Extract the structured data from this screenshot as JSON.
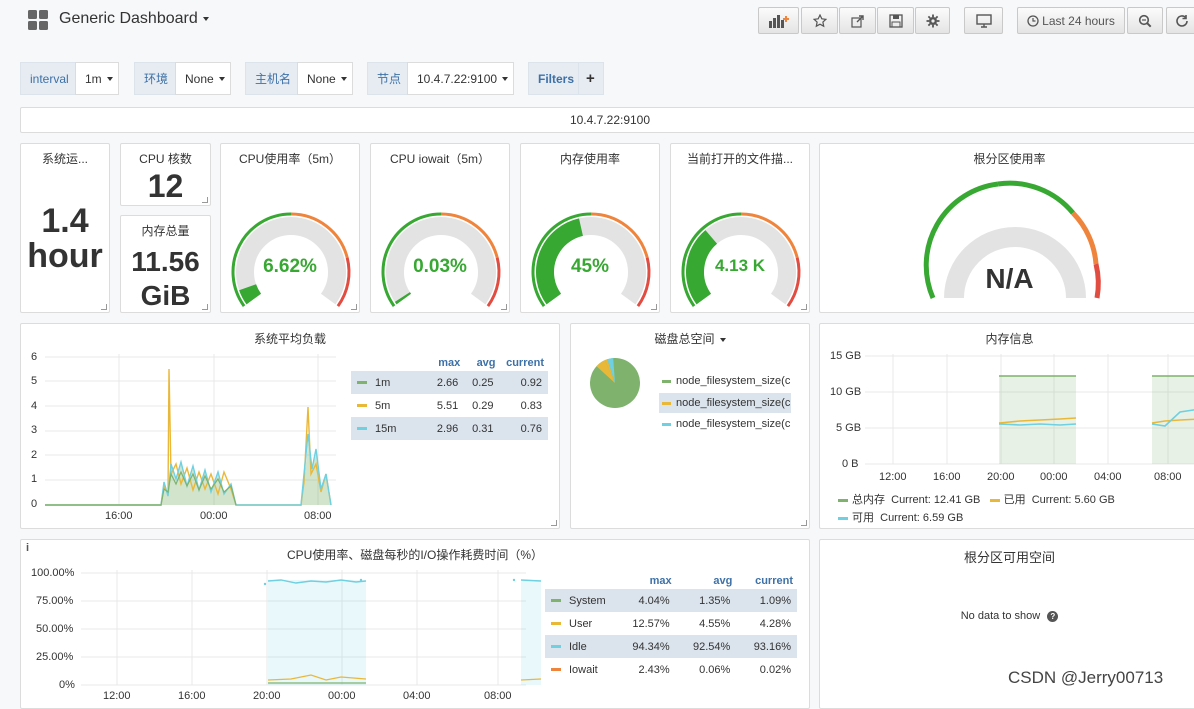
{
  "header": {
    "title": "Generic Dashboard",
    "time_range": "Last 24 hours"
  },
  "variables": [
    {
      "label": "interval",
      "value": "1m"
    },
    {
      "label": "环境",
      "value": "None"
    },
    {
      "label": "主机名",
      "value": "None"
    },
    {
      "label": "节点",
      "value": "10.4.7.22:9100"
    },
    {
      "label": "Filters",
      "value": "+"
    }
  ],
  "row_title": "10.4.7.22:9100",
  "stats": {
    "uptime": {
      "title": "系统运...",
      "value": "1.4",
      "unit": "hour"
    },
    "cpu_cores": {
      "title": "CPU 核数",
      "value": "12"
    },
    "mem_total": {
      "title": "内存总量",
      "value": "11.56",
      "unit": "GiB"
    }
  },
  "gauges": [
    {
      "title": "CPU使用率（5m）",
      "value": "6.62%",
      "fraction": 0.0662,
      "color": "#37a832"
    },
    {
      "title": "CPU iowait（5m）",
      "value": "0.03%",
      "fraction": 0.0003,
      "color": "#37a832"
    },
    {
      "title": "内存使用率",
      "value": "45%",
      "fraction": 0.45,
      "color": "#37a832"
    },
    {
      "title": "当前打开的文件描...",
      "value": "4.13 K",
      "fraction": 0.34,
      "color": "#37a832"
    }
  ],
  "root_gauge": {
    "title": "根分区使用率",
    "value": "N/A"
  },
  "load_panel": {
    "title": "系统平均负载",
    "yticks": [
      "6",
      "5",
      "4",
      "3",
      "2",
      "1",
      "0"
    ],
    "xticks": [
      "16:00",
      "00:00",
      "08:00"
    ],
    "legend_headers": [
      "max",
      "avg",
      "current"
    ],
    "legend": [
      {
        "name": "1m",
        "max": "2.66",
        "avg": "0.25",
        "current": "0.92",
        "color": "#7eb26d"
      },
      {
        "name": "5m",
        "max": "5.51",
        "avg": "0.29",
        "current": "0.83",
        "color": "#eab839"
      },
      {
        "name": "15m",
        "max": "2.96",
        "avg": "0.31",
        "current": "0.76",
        "color": "#6ed0e0"
      }
    ]
  },
  "disk_panel": {
    "title": "磁盘总空间",
    "legend": [
      {
        "name": "node_filesystem_size(c",
        "color": "#7eb26d"
      },
      {
        "name": "node_filesystem_size(c",
        "color": "#eab839"
      },
      {
        "name": "node_filesystem_size(c",
        "color": "#6ed0e0"
      }
    ],
    "slices": [
      0.91,
      0.05,
      0.04
    ]
  },
  "mem_panel": {
    "title": "内存信息",
    "yticks": [
      "15 GB",
      "10 GB",
      "5 GB",
      "0 B"
    ],
    "xticks": [
      "12:00",
      "16:00",
      "20:00",
      "00:00",
      "04:00",
      "08:00"
    ],
    "legend": [
      {
        "name": "总内存",
        "current": "Current: 12.41 GB",
        "color": "#7eb26d"
      },
      {
        "name": "已用",
        "current": "Current: 5.60 GB",
        "color": "#eab839"
      },
      {
        "name": "可用",
        "current": "Current: 6.59 GB",
        "color": "#6ed0e0"
      }
    ]
  },
  "cpu_io_panel": {
    "title": "CPU使用率、磁盘每秒的I/O操作耗费时间（%）",
    "yticks": [
      "100.00%",
      "75.00%",
      "50.00%",
      "25.00%",
      "0%"
    ],
    "xticks": [
      "12:00",
      "16:00",
      "20:00",
      "00:00",
      "04:00",
      "08:00"
    ],
    "legend_headers": [
      "max",
      "avg",
      "current"
    ],
    "legend": [
      {
        "name": "System",
        "max": "4.04%",
        "avg": "1.35%",
        "current": "1.09%",
        "color": "#7eb26d"
      },
      {
        "name": "User",
        "max": "12.57%",
        "avg": "4.55%",
        "current": "4.28%",
        "color": "#eab839"
      },
      {
        "name": "Idle",
        "max": "94.34%",
        "avg": "92.54%",
        "current": "93.16%",
        "color": "#6ed0e0"
      },
      {
        "name": "Iowait",
        "max": "2.43%",
        "avg": "0.06%",
        "current": "0.02%",
        "color": "#ef843c"
      }
    ]
  },
  "root_space_panel": {
    "title": "根分区可用空间",
    "no_data": "No data to show"
  },
  "watermark": "CSDN @Jerry00713"
}
